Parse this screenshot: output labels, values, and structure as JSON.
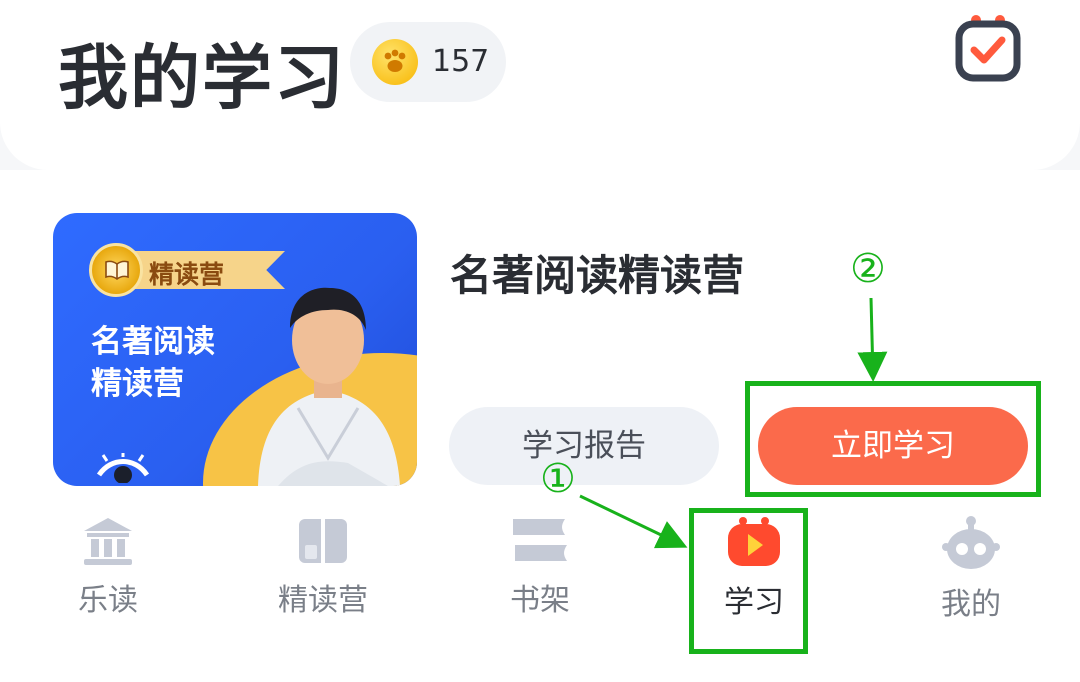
{
  "header": {
    "title": "我的学习",
    "coin_count": "157",
    "coin_icon": "paw-coin-icon",
    "checklist_icon": "checklist-icon"
  },
  "course": {
    "thumb_badge": "精读营",
    "thumb_title_line1": "名著阅读",
    "thumb_title_line2": "精读营",
    "name": "名著阅读精读营",
    "report_label": "学习报告",
    "study_label": "立即学习"
  },
  "nav": {
    "items": [
      {
        "label": "乐读",
        "icon": "library-icon"
      },
      {
        "label": "精读营",
        "icon": "book-icon"
      },
      {
        "label": "书架",
        "icon": "bookshelf-icon"
      },
      {
        "label": "学习",
        "icon": "play-icon",
        "active": true
      },
      {
        "label": "我的",
        "icon": "robot-icon"
      }
    ]
  },
  "annotations": {
    "step1": "①",
    "step2": "②",
    "color": "#18b21b"
  },
  "colors": {
    "accent": "#fb6a4b",
    "text": "#2a2d33"
  }
}
